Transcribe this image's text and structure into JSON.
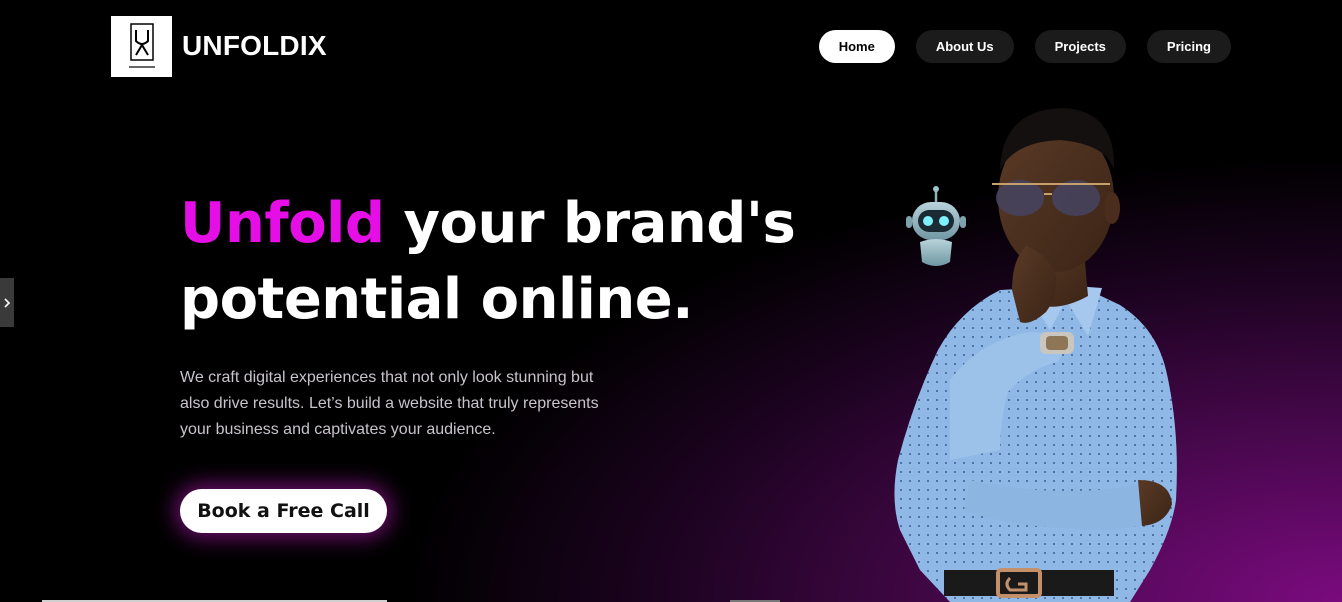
{
  "header": {
    "brand_name": "UNFOLDIX",
    "logo": {
      "mark": "UX",
      "caption": "Unfoldix",
      "icon": "ux-logo-icon"
    },
    "nav": [
      {
        "label": "Home",
        "active": true
      },
      {
        "label": "About Us",
        "active": false
      },
      {
        "label": "Projects",
        "active": false
      },
      {
        "label": "Pricing",
        "active": false
      }
    ]
  },
  "side_toggle": {
    "icon": "chevron-right-icon",
    "glyph": "›"
  },
  "hero": {
    "headline_accent": "Unfold",
    "headline_line1_rest": "your brand's",
    "headline_line2": "potential online.",
    "subcopy": "We craft digital experiences that not only look stunning but also drive results. Let’s build a website that truly represents your business and captivates your audience.",
    "cta_label": "Book a Free Call"
  },
  "images": {
    "robot_icon": "robot-icon",
    "person": "person-portrait"
  },
  "colors": {
    "accent": "#e60ee6",
    "background": "#000000",
    "gradient_purple": "#7a0a7e",
    "nav_inactive": "#1b1b1b",
    "nav_active": "#ffffff"
  }
}
